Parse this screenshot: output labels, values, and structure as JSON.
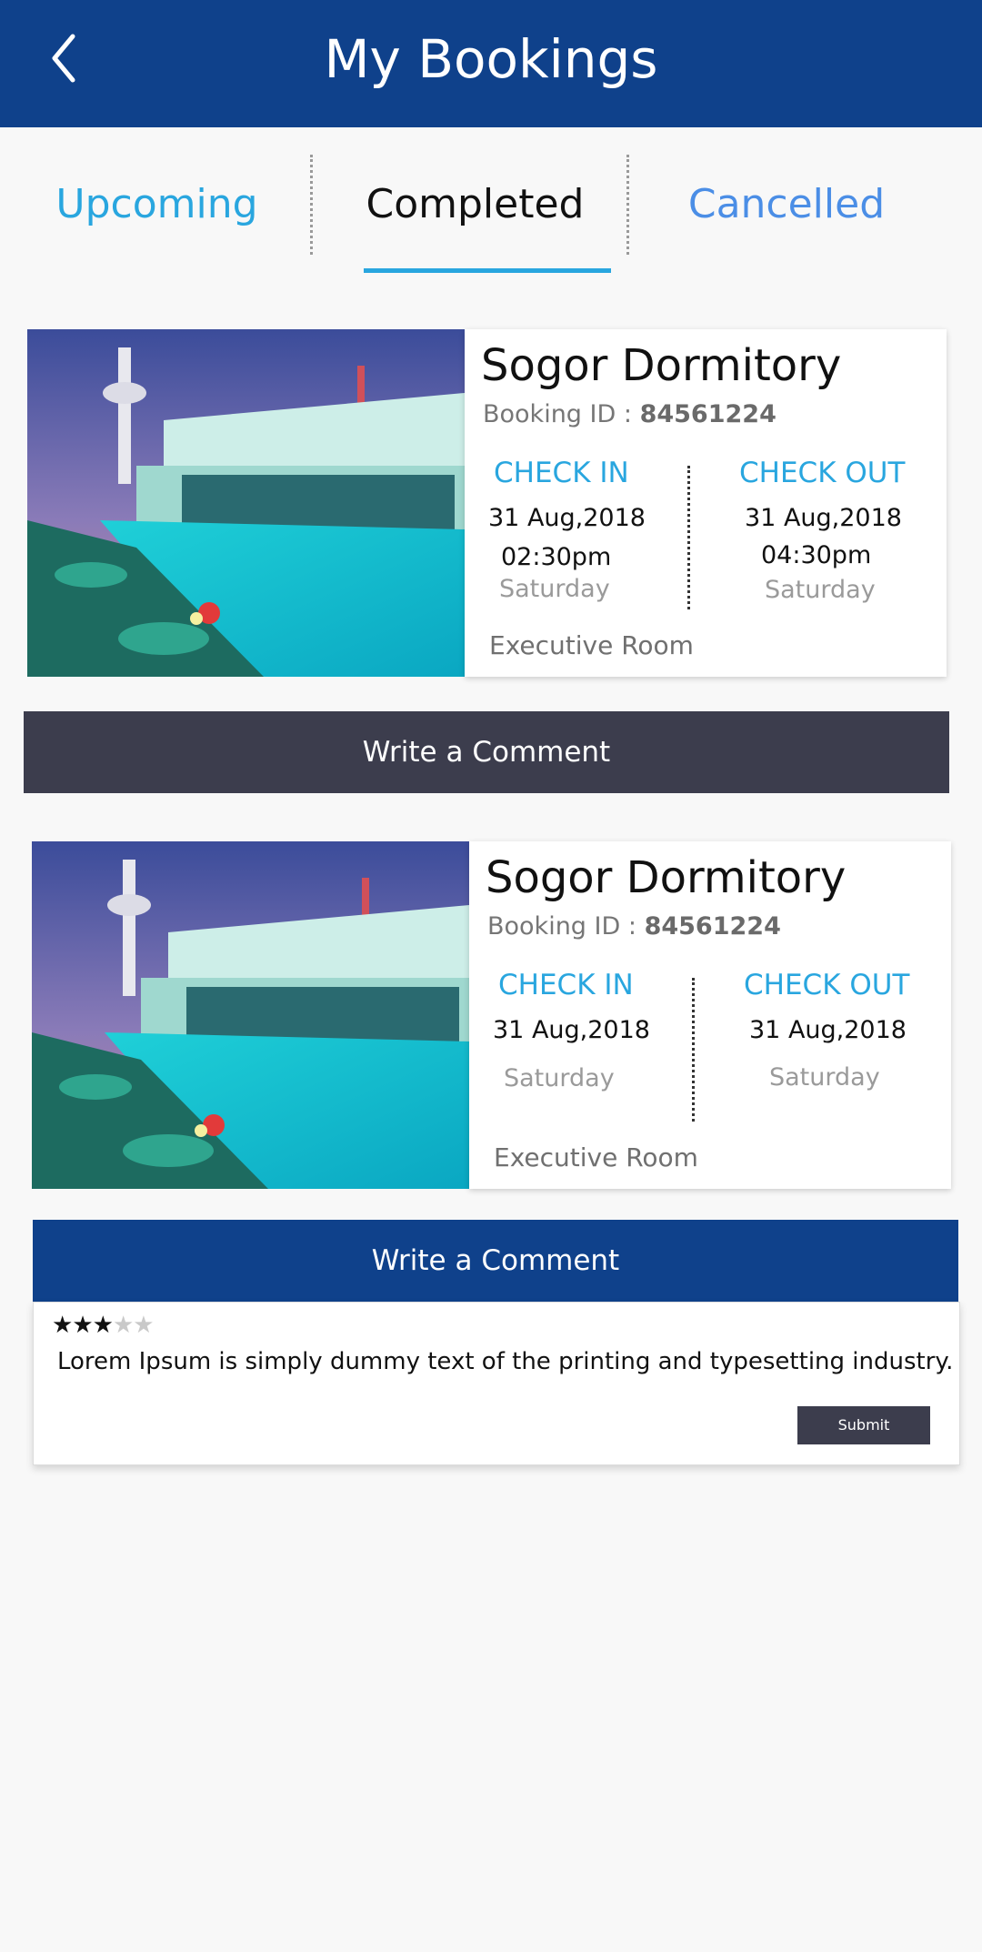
{
  "header": {
    "title": "My Bookings",
    "back_icon": "back-chevron-icon"
  },
  "tabs": [
    {
      "label": "Upcoming",
      "active": false
    },
    {
      "label": "Completed",
      "active": true
    },
    {
      "label": "Cancelled",
      "active": false
    }
  ],
  "bookings": [
    {
      "hotel_name": "Sogor Dormitory",
      "booking_id_label": "Booking ID :",
      "booking_id": "84561224",
      "check_in": {
        "label": "CHECK IN",
        "date": "31 Aug,2018",
        "time": "02:30pm",
        "day": "Saturday"
      },
      "check_out": {
        "label": "CHECK OUT",
        "date": "31 Aug,2018",
        "time": "04:30pm",
        "day": "Saturday"
      },
      "room": "Executive Room",
      "comment_button": "Write a Comment"
    },
    {
      "hotel_name": "Sogor Dormitory",
      "booking_id_label": "Booking ID :",
      "booking_id": "84561224",
      "check_in": {
        "label": "CHECK IN",
        "date": "31 Aug,2018",
        "day": "Saturday"
      },
      "check_out": {
        "label": "CHECK OUT",
        "date": "31 Aug,2018",
        "day": "Saturday"
      },
      "room": "Executive Room",
      "comment_button": "Write a Comment",
      "comment": {
        "rating": 3,
        "max_rating": 5,
        "text": "Lorem Ipsum is simply dummy text of the printing and typesetting industry.",
        "submit_label": "Submit"
      }
    }
  ],
  "colors": {
    "primary": "#0f418b",
    "accent": "#29a6df",
    "dark_button": "#3c3d4d",
    "cancelled_tab": "#4b8ee6"
  }
}
